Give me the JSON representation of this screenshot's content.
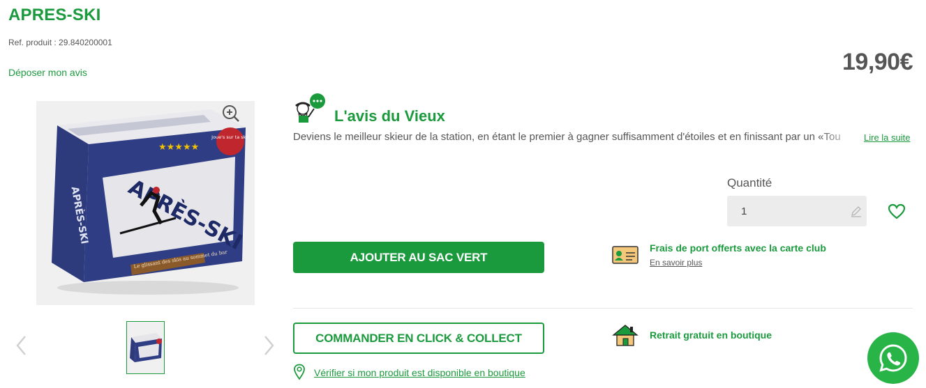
{
  "product": {
    "title": "APRES-SKI",
    "ref": "Ref. produit : 29.840200001",
    "review_link": "Déposer mon avis",
    "price": "19,90€"
  },
  "image": {
    "box_title": "APRÈS-SKI",
    "box_side": "APRÈS-SKI",
    "box_badge": "Joue's sur ta ski!",
    "box_caption": "Le glissant des skis au sommet du bar",
    "stars": "★★★★★"
  },
  "avis_du_vieux": {
    "title": "L'avis du Vieux",
    "text": "Deviens le meilleur skieur de la station, en étant le premier à gagner suffisamment d'étoiles et en finissant par un «Tou",
    "read_more": "Lire la suite"
  },
  "quantity": {
    "label": "Quantité",
    "value": "1"
  },
  "actions": {
    "add_to_bag": "AJOUTER AU SAC VERT",
    "click_collect": "COMMANDER EN CLICK & COLLECT",
    "check_store": "Vérifier si mon produit est disponible en boutique"
  },
  "services": {
    "shipping_title": "Frais de port offerts avec la carte club",
    "shipping_link": "En savoir plus",
    "pickup_title": "Retrait gratuit en boutique"
  },
  "colors": {
    "brand_green": "#1a9a3c",
    "price_gray": "#555555",
    "whatsapp_green": "#28b446"
  },
  "icons": [
    "zoom-in-icon",
    "chevron-left-icon",
    "chevron-right-icon",
    "vieux-mascot-icon",
    "pencil-icon",
    "heart-icon",
    "map-pin-icon",
    "club-card-icon",
    "house-icon",
    "whatsapp-icon"
  ]
}
